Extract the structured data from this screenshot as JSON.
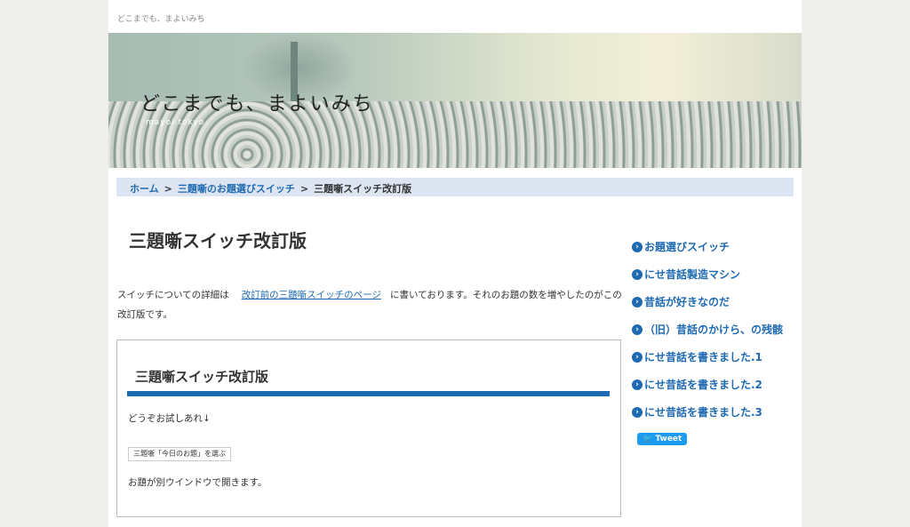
{
  "header": {
    "tagline": "どこまでも、まよいみち"
  },
  "banner": {
    "title": "どこまでも、まよいみち",
    "subtitle": "mayoi.tokyo"
  },
  "breadcrumb": {
    "home": "ホーム",
    "parent": "三題噺のお題選びスイッチ",
    "current": "三題噺スイッチ改訂版",
    "separator": ">"
  },
  "article": {
    "title": "三題噺スイッチ改訂版",
    "para_before": "スイッチについての詳細は",
    "link": "改訂前の三題噺スイッチのページ",
    "para_after": "に書いております。それのお題の数を増やしたのがこの改訂版です。",
    "box_title": "三題噺スイッチ改訂版",
    "try_text": "どうぞお試しあれ↓",
    "button": "三題噺「今日のお題」を選ぶ",
    "note": "お題が別ウインドウで開きます。"
  },
  "sidebar": {
    "items": [
      "お題選びスイッチ",
      "にせ昔話製造マシン",
      "昔話が好きなのだ",
      "（旧）昔話のかけら、の残骸",
      "にせ昔話を書きました.1",
      "にせ昔話を書きました.2",
      "にせ昔話を書きました.3"
    ],
    "tweet": "Tweet"
  },
  "colors": {
    "accent": "#1e6ab2",
    "breadcrumb_bg": "#dde5f2"
  }
}
